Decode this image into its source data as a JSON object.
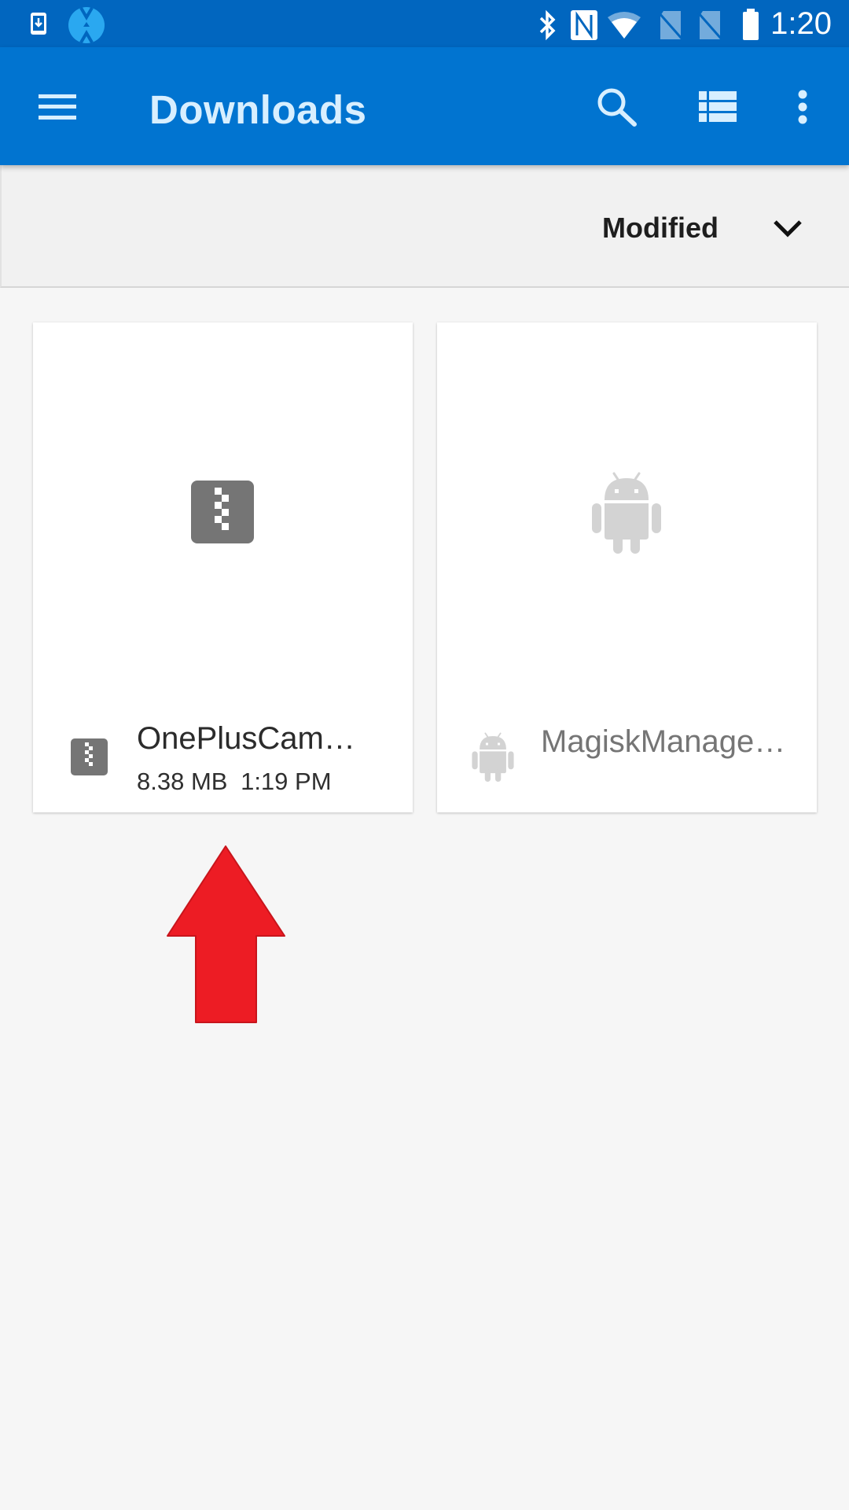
{
  "status_bar": {
    "left_icons": [
      "download-notification-icon",
      "twrp-icon"
    ],
    "right_icons": [
      "bluetooth-icon",
      "nfc-icon",
      "wifi-icon",
      "no-sim-icon",
      "no-sim-icon",
      "battery-icon"
    ],
    "time": "1:20"
  },
  "toolbar": {
    "menu_icon": "hamburger-menu-icon",
    "title": "Downloads",
    "actions": [
      "search-icon",
      "list-view-icon",
      "more-options-icon"
    ]
  },
  "sort_bar": {
    "label": "Modified",
    "icon": "chevron-down-icon"
  },
  "files": [
    {
      "name": "OnePlusCamer…",
      "size": "8.38 MB",
      "modified": "1:19 PM",
      "type_icon": "zip-archive-icon",
      "enabled": true
    },
    {
      "name": "MagiskManage…",
      "size": "",
      "modified": "",
      "type_icon": "android-apk-icon",
      "enabled": false
    }
  ],
  "annotation": {
    "type": "arrow-up",
    "color": "#ed1c24"
  },
  "colors": {
    "status_bar": "#0166bf",
    "toolbar": "#0174d0",
    "toolbar_text": "#d8efff",
    "background": "#f6f6f6",
    "sort_bar": "#f1f1f1",
    "zip_icon": "#757575",
    "android_icon": "#d3d3d3"
  }
}
